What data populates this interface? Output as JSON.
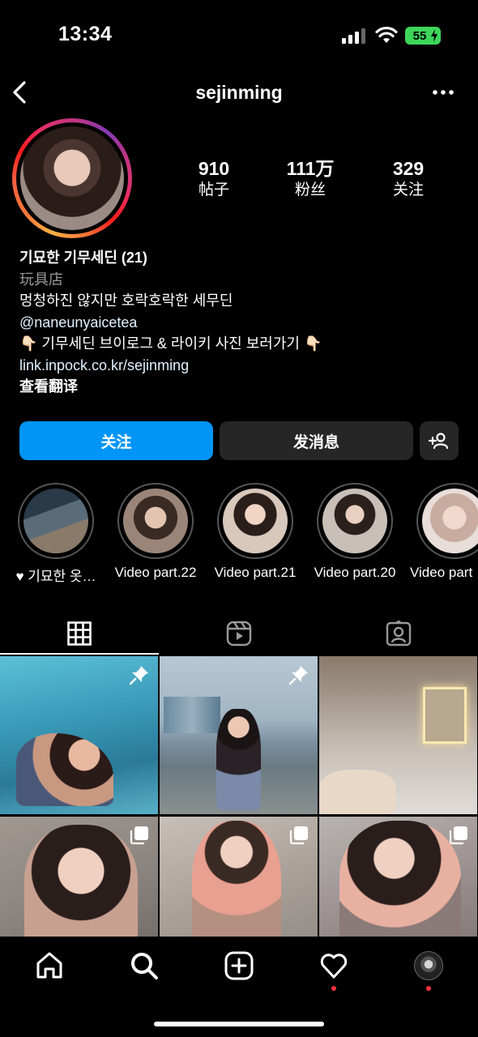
{
  "status_bar": {
    "time": "13:34",
    "battery": "55"
  },
  "header": {
    "username": "sejinming"
  },
  "profile": {
    "stats": [
      {
        "value": "910",
        "label": "帖子"
      },
      {
        "value": "111万",
        "label": "粉丝"
      },
      {
        "value": "329",
        "label": "关注"
      }
    ],
    "name": "기묘한 기무세딘 (21)",
    "category": "玩具店",
    "bio_lines": [
      "멍청하진 않지만 호락호락한 세무딘",
      "@naneunyaicetea",
      "👇🏻 기무세딘 브이로그 & 라이키 사진 보러가기 👇🏻"
    ],
    "link": "link.inpock.co.kr/sejinming",
    "translate": "查看翻译"
  },
  "actions": {
    "follow": "关注",
    "message": "发消息"
  },
  "highlights": [
    {
      "label": "♥ 기묘한 옷…",
      "color": "#5a6b7a"
    },
    {
      "label": "Video part.22",
      "color": "#9a8578"
    },
    {
      "label": "Video part.21",
      "color": "#b39a8c"
    },
    {
      "label": "Video part.20",
      "color": "#8a7a72"
    },
    {
      "label": "Video part",
      "color": "#c8aca0"
    }
  ],
  "tabs": [
    "grid-icon",
    "reels-icon",
    "tagged-icon"
  ],
  "posts": [
    {
      "badge": "pin-icon",
      "color": "#4aa8c0"
    },
    {
      "badge": "pin-icon",
      "color": "#7a8fa0"
    },
    {
      "badge": "",
      "color": "#a89c90"
    },
    {
      "badge": "carousel-icon",
      "color": "#8a8480"
    },
    {
      "badge": "carousel-icon",
      "color": "#b49080"
    },
    {
      "badge": "carousel-icon",
      "color": "#9a9090"
    }
  ],
  "bottom_nav": [
    "home-icon",
    "search-icon",
    "create-icon",
    "activity-icon",
    "profile-icon"
  ]
}
